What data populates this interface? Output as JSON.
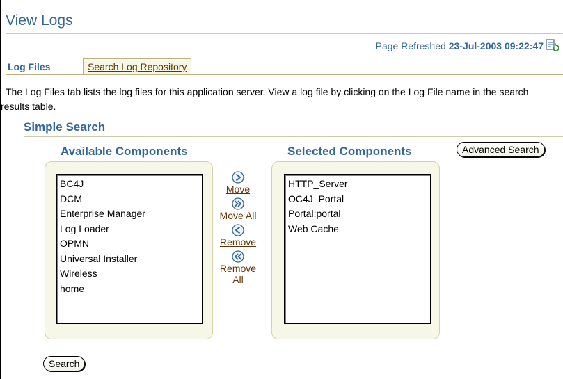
{
  "page": {
    "title": "View Logs",
    "refresh_prefix": "Page Refreshed",
    "refresh_timestamp": "23-Jul-2003 09:22:47"
  },
  "tabs": [
    {
      "label": "Log Files",
      "active": true
    },
    {
      "label": "Search Log Repository",
      "active": false
    }
  ],
  "description": "The Log Files tab lists the log files for this application server. View a log file by clicking on the Log File name in the search results table.",
  "search": {
    "section_title": "Simple Search",
    "advanced_button": "Advanced Search",
    "search_button": "Search",
    "available": {
      "heading": "Available Components",
      "items": [
        "BC4J",
        "DCM",
        "Enterprise Manager",
        "Log Loader",
        "OPMN",
        "Universal Installer",
        "Wireless",
        "home"
      ]
    },
    "selected": {
      "heading": "Selected Components",
      "items": [
        "HTTP_Server",
        "OC4J_Portal",
        "Portal:portal",
        "Web Cache"
      ]
    },
    "shuttle": {
      "move": "Move",
      "move_all": "Move All",
      "remove": "Remove",
      "remove_all_1": "Remove",
      "remove_all_2": "All"
    }
  },
  "colors": {
    "heading_blue": "#336699",
    "link_brown": "#663300",
    "panel_beige": "#f7f7e7"
  }
}
